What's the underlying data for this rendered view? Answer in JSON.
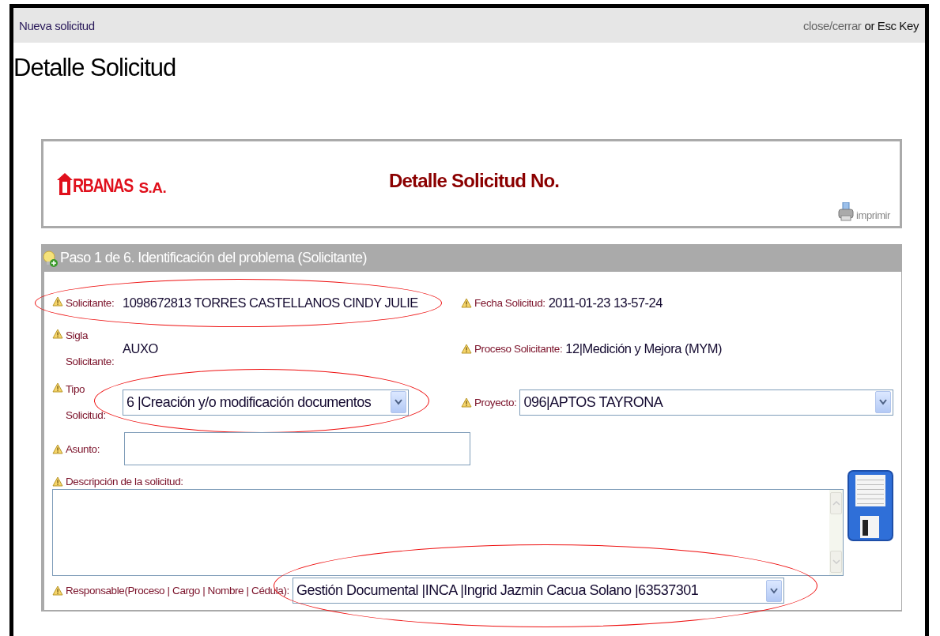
{
  "top_bar": {
    "title": "Nueva solicitud",
    "close_link": "close/cerrar",
    "close_hint": "or Esc Key"
  },
  "page_title": "Detalle Solicitud",
  "header": {
    "logo_text": "RBANAS",
    "logo_suffix": "S.A.",
    "title": "Detalle Solicitud No.",
    "print_link": "imprimir"
  },
  "panel": {
    "title": "Paso 1 de 6. Identificación del problema (Solicitante)",
    "rows": [
      {
        "fields": [
          {
            "kind": "text",
            "label": "Solicitante:",
            "value": "1098672813 TORRES CASTELLANOS CINDY JULIE",
            "circled": true
          },
          {
            "kind": "text",
            "label": "Fecha Solicitud:",
            "value": "2011-01-23 13-57-24",
            "circled": false
          }
        ]
      },
      {
        "fields": [
          {
            "kind": "text",
            "label": "Sigla Solicitante:",
            "value": "AUXO",
            "circled": false
          },
          {
            "kind": "text",
            "label": "Proceso Solicitante:",
            "value": "12|Medición y Mejora (MYM)",
            "circled": false
          }
        ]
      },
      {
        "fields": [
          {
            "kind": "select",
            "label": "Tipo Solicitud:",
            "value": "6 |Creación y/o modificación documentos",
            "circled": true
          },
          {
            "kind": "select",
            "label": "Proyecto:",
            "value": "096|APTOS TAYRONA",
            "circled": false
          }
        ]
      },
      {
        "fields": [
          {
            "kind": "input",
            "label": "Asunto:",
            "circled": false
          }
        ]
      },
      {
        "fields": [
          {
            "kind": "textarea",
            "label": "Descripción de la solicitud:",
            "circled": false
          }
        ]
      },
      {
        "fields": [
          {
            "kind": "wide_select",
            "label": "Responsable(Proceso | Cargo | Nombre | Cédula):",
            "value": "Gestión Documental |INCA |Ingrid Jazmin Cacua Solano |63537301",
            "circled": true
          }
        ]
      }
    ]
  }
}
